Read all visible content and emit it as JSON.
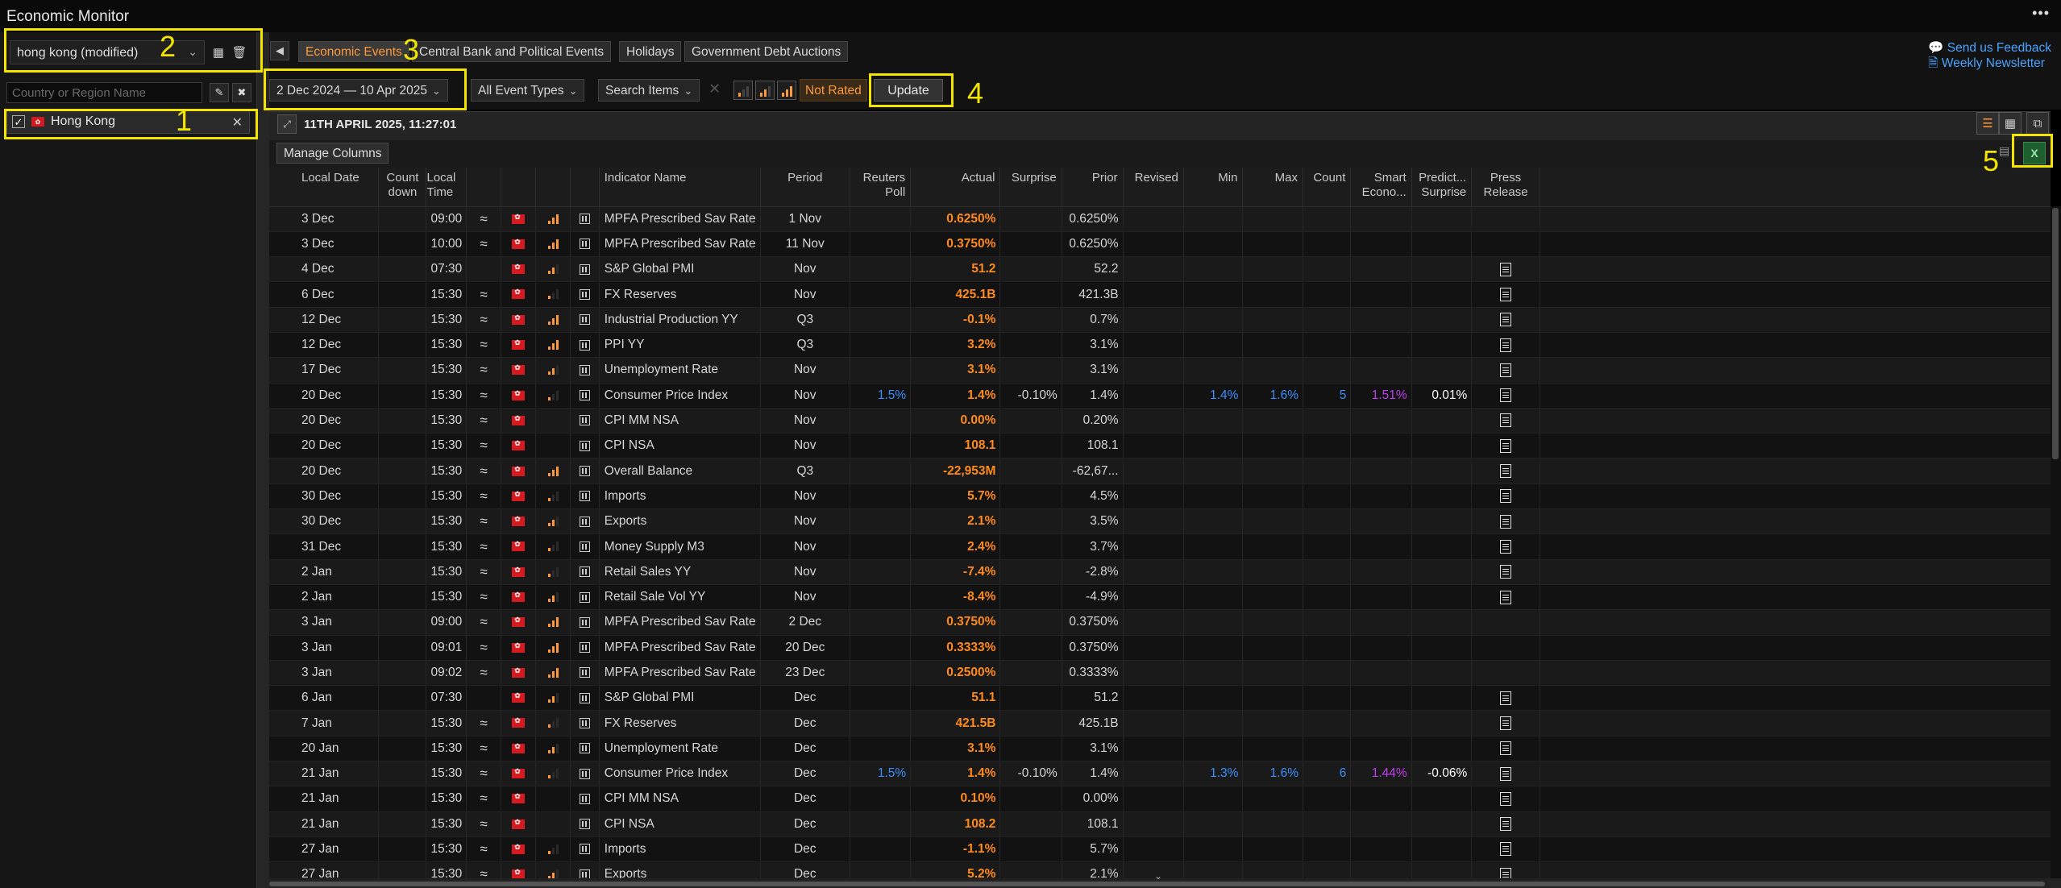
{
  "app": {
    "title": "Economic Monitor",
    "more_label": "•••"
  },
  "left": {
    "profile": "hong kong (modified)",
    "country_placeholder": "Country or Region Name",
    "selected_country": "Hong Kong"
  },
  "tabs": [
    "Economic Events",
    "Central Bank and Political Events",
    "Holidays",
    "Government Debt Auctions"
  ],
  "links": {
    "feedback": "Send us Feedback",
    "newsletter": "Weekly Newsletter"
  },
  "filters": {
    "date_range": "2 Dec 2024 — 10 Apr 2025",
    "event_types": "All Event Types",
    "search_items": "Search Items",
    "rating": "Not Rated",
    "update": "Update"
  },
  "grid": {
    "timestamp": "11TH APRIL 2025, 11:27:01",
    "manage_columns": "Manage Columns"
  },
  "annotations": [
    "1",
    "2",
    "3",
    "4",
    "5"
  ],
  "columns": [
    "Local Date",
    "Count down",
    "Local Time",
    "",
    "",
    "",
    "",
    "Indicator Name",
    "Period",
    "Reuters Poll",
    "Actual",
    "Surprise",
    "Prior",
    "Revised",
    "Min",
    "Max",
    "Count",
    "Smart Econo...",
    "Predict... Surprise",
    "Press Release"
  ],
  "rows": [
    {
      "date": "3 Dec",
      "time": "09:00",
      "wave": true,
      "bars": 3,
      "cal": true,
      "name": "MPFA Prescribed Sav Rate",
      "period": "1 Nov",
      "poll": "",
      "actual": "0.6250%",
      "surprise": "",
      "prior": "0.6250%",
      "min": "",
      "max": "",
      "count": "",
      "smart": "",
      "pred": "",
      "press": false
    },
    {
      "date": "3 Dec",
      "time": "10:00",
      "wave": true,
      "bars": 3,
      "cal": true,
      "name": "MPFA Prescribed Sav Rate",
      "period": "11 Nov",
      "poll": "",
      "actual": "0.3750%",
      "surprise": "",
      "prior": "0.6250%",
      "min": "",
      "max": "",
      "count": "",
      "smart": "",
      "pred": "",
      "press": false
    },
    {
      "date": "4 Dec",
      "time": "07:30",
      "wave": false,
      "bars": 2,
      "cal": true,
      "name": "S&P Global PMI",
      "period": "Nov",
      "poll": "",
      "actual": "51.2",
      "surprise": "",
      "prior": "52.2",
      "min": "",
      "max": "",
      "count": "",
      "smart": "",
      "pred": "",
      "press": true
    },
    {
      "date": "6 Dec",
      "time": "15:30",
      "wave": true,
      "bars": 1,
      "cal": true,
      "name": "FX Reserves",
      "period": "Nov",
      "poll": "",
      "actual": "425.1B",
      "surprise": "",
      "prior": "421.3B",
      "min": "",
      "max": "",
      "count": "",
      "smart": "",
      "pred": "",
      "press": true
    },
    {
      "date": "12 Dec",
      "time": "15:30",
      "wave": true,
      "bars": 3,
      "cal": true,
      "name": "Industrial Production YY",
      "period": "Q3",
      "poll": "",
      "actual": "-0.1%",
      "surprise": "",
      "prior": "0.7%",
      "min": "",
      "max": "",
      "count": "",
      "smart": "",
      "pred": "",
      "press": true
    },
    {
      "date": "12 Dec",
      "time": "15:30",
      "wave": true,
      "bars": 3,
      "cal": true,
      "name": "PPI YY",
      "period": "Q3",
      "poll": "",
      "actual": "3.2%",
      "surprise": "",
      "prior": "3.1%",
      "min": "",
      "max": "",
      "count": "",
      "smart": "",
      "pred": "",
      "press": true
    },
    {
      "date": "17 Dec",
      "time": "15:30",
      "wave": true,
      "bars": 2,
      "cal": true,
      "name": "Unemployment Rate",
      "period": "Nov",
      "poll": "",
      "actual": "3.1%",
      "surprise": "",
      "prior": "3.1%",
      "min": "",
      "max": "",
      "count": "",
      "smart": "",
      "pred": "",
      "press": true
    },
    {
      "date": "20 Dec",
      "time": "15:30",
      "wave": true,
      "bars": 1,
      "cal": true,
      "name": "Consumer Price Index",
      "period": "Nov",
      "poll": "1.5%",
      "actual": "1.4%",
      "surprise": "-0.10%",
      "prior": "1.4%",
      "min": "1.4%",
      "max": "1.6%",
      "count": "5",
      "smart": "1.51%",
      "pred": "0.01%",
      "press": true
    },
    {
      "date": "20 Dec",
      "time": "15:30",
      "wave": true,
      "bars": 0,
      "cal": true,
      "name": "CPI MM NSA",
      "period": "Nov",
      "poll": "",
      "actual": "0.00%",
      "surprise": "",
      "prior": "0.20%",
      "min": "",
      "max": "",
      "count": "",
      "smart": "",
      "pred": "",
      "press": true
    },
    {
      "date": "20 Dec",
      "time": "15:30",
      "wave": true,
      "bars": 0,
      "cal": true,
      "name": "CPI NSA",
      "period": "Nov",
      "poll": "",
      "actual": "108.1",
      "surprise": "",
      "prior": "108.1",
      "min": "",
      "max": "",
      "count": "",
      "smart": "",
      "pred": "",
      "press": true
    },
    {
      "date": "20 Dec",
      "time": "15:30",
      "wave": true,
      "bars": 3,
      "cal": true,
      "name": "Overall Balance",
      "period": "Q3",
      "poll": "",
      "actual": "-22,953M",
      "surprise": "",
      "prior": "-62,67...",
      "min": "",
      "max": "",
      "count": "",
      "smart": "",
      "pred": "",
      "press": true
    },
    {
      "date": "30 Dec",
      "time": "15:30",
      "wave": true,
      "bars": 1,
      "cal": true,
      "name": "Imports",
      "period": "Nov",
      "poll": "",
      "actual": "5.7%",
      "surprise": "",
      "prior": "4.5%",
      "min": "",
      "max": "",
      "count": "",
      "smart": "",
      "pred": "",
      "press": true
    },
    {
      "date": "30 Dec",
      "time": "15:30",
      "wave": true,
      "bars": 2,
      "cal": true,
      "name": "Exports",
      "period": "Nov",
      "poll": "",
      "actual": "2.1%",
      "surprise": "",
      "prior": "3.5%",
      "min": "",
      "max": "",
      "count": "",
      "smart": "",
      "pred": "",
      "press": true
    },
    {
      "date": "31 Dec",
      "time": "15:30",
      "wave": true,
      "bars": 1,
      "cal": true,
      "name": "Money Supply M3",
      "period": "Nov",
      "poll": "",
      "actual": "2.4%",
      "surprise": "",
      "prior": "3.7%",
      "min": "",
      "max": "",
      "count": "",
      "smart": "",
      "pred": "",
      "press": true
    },
    {
      "date": "2 Jan",
      "time": "15:30",
      "wave": true,
      "bars": 1,
      "cal": true,
      "name": "Retail Sales YY",
      "period": "Nov",
      "poll": "",
      "actual": "-7.4%",
      "surprise": "",
      "prior": "-2.8%",
      "min": "",
      "max": "",
      "count": "",
      "smart": "",
      "pred": "",
      "press": true
    },
    {
      "date": "2 Jan",
      "time": "15:30",
      "wave": true,
      "bars": 2,
      "cal": true,
      "name": "Retail Sale Vol YY",
      "period": "Nov",
      "poll": "",
      "actual": "-8.4%",
      "surprise": "",
      "prior": "-4.9%",
      "min": "",
      "max": "",
      "count": "",
      "smart": "",
      "pred": "",
      "press": true
    },
    {
      "date": "3 Jan",
      "time": "09:00",
      "wave": true,
      "bars": 3,
      "cal": true,
      "name": "MPFA Prescribed Sav Rate",
      "period": "2 Dec",
      "poll": "",
      "actual": "0.3750%",
      "surprise": "",
      "prior": "0.3750%",
      "min": "",
      "max": "",
      "count": "",
      "smart": "",
      "pred": "",
      "press": false
    },
    {
      "date": "3 Jan",
      "time": "09:01",
      "wave": true,
      "bars": 3,
      "cal": true,
      "name": "MPFA Prescribed Sav Rate",
      "period": "20 Dec",
      "poll": "",
      "actual": "0.3333%",
      "surprise": "",
      "prior": "0.3750%",
      "min": "",
      "max": "",
      "count": "",
      "smart": "",
      "pred": "",
      "press": false
    },
    {
      "date": "3 Jan",
      "time": "09:02",
      "wave": true,
      "bars": 3,
      "cal": true,
      "name": "MPFA Prescribed Sav Rate",
      "period": "23 Dec",
      "poll": "",
      "actual": "0.2500%",
      "surprise": "",
      "prior": "0.3333%",
      "min": "",
      "max": "",
      "count": "",
      "smart": "",
      "pred": "",
      "press": false
    },
    {
      "date": "6 Jan",
      "time": "07:30",
      "wave": false,
      "bars": 2,
      "cal": true,
      "name": "S&P Global PMI",
      "period": "Dec",
      "poll": "",
      "actual": "51.1",
      "surprise": "",
      "prior": "51.2",
      "min": "",
      "max": "",
      "count": "",
      "smart": "",
      "pred": "",
      "press": true
    },
    {
      "date": "7 Jan",
      "time": "15:30",
      "wave": true,
      "bars": 1,
      "cal": true,
      "name": "FX Reserves",
      "period": "Dec",
      "poll": "",
      "actual": "421.5B",
      "surprise": "",
      "prior": "425.1B",
      "min": "",
      "max": "",
      "count": "",
      "smart": "",
      "pred": "",
      "press": true
    },
    {
      "date": "20 Jan",
      "time": "15:30",
      "wave": true,
      "bars": 2,
      "cal": true,
      "name": "Unemployment Rate",
      "period": "Dec",
      "poll": "",
      "actual": "3.1%",
      "surprise": "",
      "prior": "3.1%",
      "min": "",
      "max": "",
      "count": "",
      "smart": "",
      "pred": "",
      "press": true
    },
    {
      "date": "21 Jan",
      "time": "15:30",
      "wave": true,
      "bars": 1,
      "cal": true,
      "name": "Consumer Price Index",
      "period": "Dec",
      "poll": "1.5%",
      "actual": "1.4%",
      "surprise": "-0.10%",
      "prior": "1.4%",
      "min": "1.3%",
      "max": "1.6%",
      "count": "6",
      "smart": "1.44%",
      "pred": "-0.06%",
      "press": true
    },
    {
      "date": "21 Jan",
      "time": "15:30",
      "wave": true,
      "bars": 0,
      "cal": true,
      "name": "CPI MM NSA",
      "period": "Dec",
      "poll": "",
      "actual": "0.10%",
      "surprise": "",
      "prior": "0.00%",
      "min": "",
      "max": "",
      "count": "",
      "smart": "",
      "pred": "",
      "press": true
    },
    {
      "date": "21 Jan",
      "time": "15:30",
      "wave": true,
      "bars": 0,
      "cal": true,
      "name": "CPI NSA",
      "period": "Dec",
      "poll": "",
      "actual": "108.2",
      "surprise": "",
      "prior": "108.1",
      "min": "",
      "max": "",
      "count": "",
      "smart": "",
      "pred": "",
      "press": true
    },
    {
      "date": "27 Jan",
      "time": "15:30",
      "wave": true,
      "bars": 1,
      "cal": true,
      "name": "Imports",
      "period": "Dec",
      "poll": "",
      "actual": "-1.1%",
      "surprise": "",
      "prior": "5.7%",
      "min": "",
      "max": "",
      "count": "",
      "smart": "",
      "pred": "",
      "press": true
    },
    {
      "date": "27 Jan",
      "time": "15:30",
      "wave": true,
      "bars": 2,
      "cal": true,
      "name": "Exports",
      "period": "Dec",
      "poll": "",
      "actual": "5.2%",
      "surprise": "",
      "prior": "2.1%",
      "min": "",
      "max": "",
      "count": "",
      "smart": "",
      "pred": "",
      "press": true
    }
  ],
  "colors": {
    "accent": "#ff9a3c",
    "annotation": "#f4e500",
    "link": "#4aa3ff",
    "blue_values": "#3d8fff",
    "purple_values": "#c13df0"
  }
}
